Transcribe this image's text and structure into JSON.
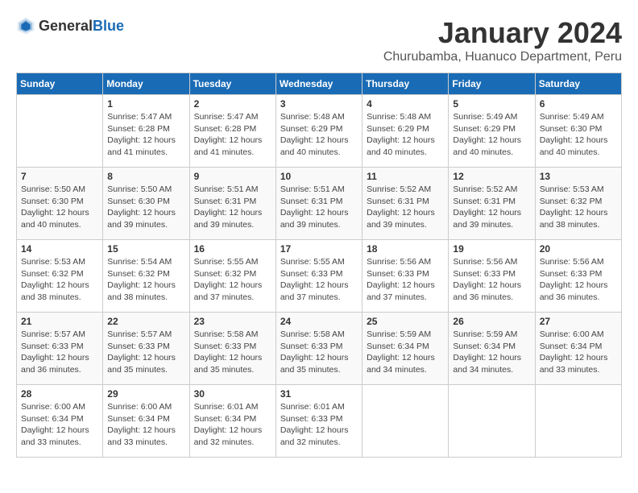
{
  "header": {
    "logo_general": "General",
    "logo_blue": "Blue",
    "month_title": "January 2024",
    "location": "Churubamba, Huanuco Department, Peru"
  },
  "weekdays": [
    "Sunday",
    "Monday",
    "Tuesday",
    "Wednesday",
    "Thursday",
    "Friday",
    "Saturday"
  ],
  "weeks": [
    [
      {
        "day": "",
        "text": ""
      },
      {
        "day": "1",
        "text": "Sunrise: 5:47 AM\nSunset: 6:28 PM\nDaylight: 12 hours\nand 41 minutes."
      },
      {
        "day": "2",
        "text": "Sunrise: 5:47 AM\nSunset: 6:28 PM\nDaylight: 12 hours\nand 41 minutes."
      },
      {
        "day": "3",
        "text": "Sunrise: 5:48 AM\nSunset: 6:29 PM\nDaylight: 12 hours\nand 40 minutes."
      },
      {
        "day": "4",
        "text": "Sunrise: 5:48 AM\nSunset: 6:29 PM\nDaylight: 12 hours\nand 40 minutes."
      },
      {
        "day": "5",
        "text": "Sunrise: 5:49 AM\nSunset: 6:29 PM\nDaylight: 12 hours\nand 40 minutes."
      },
      {
        "day": "6",
        "text": "Sunrise: 5:49 AM\nSunset: 6:30 PM\nDaylight: 12 hours\nand 40 minutes."
      }
    ],
    [
      {
        "day": "7",
        "text": "Sunrise: 5:50 AM\nSunset: 6:30 PM\nDaylight: 12 hours\nand 40 minutes."
      },
      {
        "day": "8",
        "text": "Sunrise: 5:50 AM\nSunset: 6:30 PM\nDaylight: 12 hours\nand 39 minutes."
      },
      {
        "day": "9",
        "text": "Sunrise: 5:51 AM\nSunset: 6:31 PM\nDaylight: 12 hours\nand 39 minutes."
      },
      {
        "day": "10",
        "text": "Sunrise: 5:51 AM\nSunset: 6:31 PM\nDaylight: 12 hours\nand 39 minutes."
      },
      {
        "day": "11",
        "text": "Sunrise: 5:52 AM\nSunset: 6:31 PM\nDaylight: 12 hours\nand 39 minutes."
      },
      {
        "day": "12",
        "text": "Sunrise: 5:52 AM\nSunset: 6:31 PM\nDaylight: 12 hours\nand 39 minutes."
      },
      {
        "day": "13",
        "text": "Sunrise: 5:53 AM\nSunset: 6:32 PM\nDaylight: 12 hours\nand 38 minutes."
      }
    ],
    [
      {
        "day": "14",
        "text": "Sunrise: 5:53 AM\nSunset: 6:32 PM\nDaylight: 12 hours\nand 38 minutes."
      },
      {
        "day": "15",
        "text": "Sunrise: 5:54 AM\nSunset: 6:32 PM\nDaylight: 12 hours\nand 38 minutes."
      },
      {
        "day": "16",
        "text": "Sunrise: 5:55 AM\nSunset: 6:32 PM\nDaylight: 12 hours\nand 37 minutes."
      },
      {
        "day": "17",
        "text": "Sunrise: 5:55 AM\nSunset: 6:33 PM\nDaylight: 12 hours\nand 37 minutes."
      },
      {
        "day": "18",
        "text": "Sunrise: 5:56 AM\nSunset: 6:33 PM\nDaylight: 12 hours\nand 37 minutes."
      },
      {
        "day": "19",
        "text": "Sunrise: 5:56 AM\nSunset: 6:33 PM\nDaylight: 12 hours\nand 36 minutes."
      },
      {
        "day": "20",
        "text": "Sunrise: 5:56 AM\nSunset: 6:33 PM\nDaylight: 12 hours\nand 36 minutes."
      }
    ],
    [
      {
        "day": "21",
        "text": "Sunrise: 5:57 AM\nSunset: 6:33 PM\nDaylight: 12 hours\nand 36 minutes."
      },
      {
        "day": "22",
        "text": "Sunrise: 5:57 AM\nSunset: 6:33 PM\nDaylight: 12 hours\nand 35 minutes."
      },
      {
        "day": "23",
        "text": "Sunrise: 5:58 AM\nSunset: 6:33 PM\nDaylight: 12 hours\nand 35 minutes."
      },
      {
        "day": "24",
        "text": "Sunrise: 5:58 AM\nSunset: 6:33 PM\nDaylight: 12 hours\nand 35 minutes."
      },
      {
        "day": "25",
        "text": "Sunrise: 5:59 AM\nSunset: 6:34 PM\nDaylight: 12 hours\nand 34 minutes."
      },
      {
        "day": "26",
        "text": "Sunrise: 5:59 AM\nSunset: 6:34 PM\nDaylight: 12 hours\nand 34 minutes."
      },
      {
        "day": "27",
        "text": "Sunrise: 6:00 AM\nSunset: 6:34 PM\nDaylight: 12 hours\nand 33 minutes."
      }
    ],
    [
      {
        "day": "28",
        "text": "Sunrise: 6:00 AM\nSunset: 6:34 PM\nDaylight: 12 hours\nand 33 minutes."
      },
      {
        "day": "29",
        "text": "Sunrise: 6:00 AM\nSunset: 6:34 PM\nDaylight: 12 hours\nand 33 minutes."
      },
      {
        "day": "30",
        "text": "Sunrise: 6:01 AM\nSunset: 6:34 PM\nDaylight: 12 hours\nand 32 minutes."
      },
      {
        "day": "31",
        "text": "Sunrise: 6:01 AM\nSunset: 6:33 PM\nDaylight: 12 hours\nand 32 minutes."
      },
      {
        "day": "",
        "text": ""
      },
      {
        "day": "",
        "text": ""
      },
      {
        "day": "",
        "text": ""
      }
    ]
  ]
}
